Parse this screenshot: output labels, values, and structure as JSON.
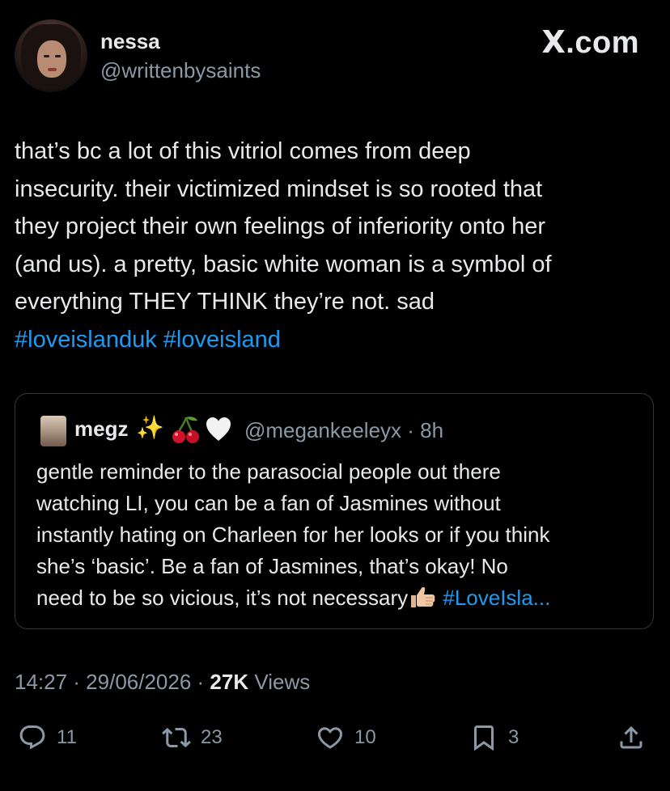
{
  "author": {
    "display_name": "nessa",
    "handle": "@writtenbysaints"
  },
  "watermark": "X.com",
  "tweet": {
    "lines": [
      "that’s bc a lot of this vitriol comes from deep",
      "insecurity. their victimized mindset is so rooted that",
      "they project their own feelings of inferiority onto her",
      "(and us). a pretty, basic white woman is a symbol of",
      "everything THEY THINK they’re not. sad"
    ],
    "hashtags": [
      "#loveislanduk",
      "#loveisland"
    ]
  },
  "quote": {
    "display_name": "megz",
    "handle_time": "@megankeeleyx · 8h",
    "lines": [
      "gentle reminder to the parasocial people out there",
      "watching LI, you can be a fan of Jasmines without",
      "instantly hating on Charleen for her looks or if you think",
      "she’s ‘basic’. Be a fan of Jasmines, that’s okay! No"
    ],
    "last_line_text": "need to be so vicious, it’s not necessary",
    "last_line_tag": "#LoveIsla..."
  },
  "meta": {
    "time_date": "14:27 · 29/06/2026 · ",
    "views_count": "27K",
    "views_label": " Views"
  },
  "actions": {
    "replies": "11",
    "reposts": "23",
    "likes": "10",
    "bookmarks": "3"
  },
  "colors": {
    "background": "#000000",
    "text": "#e7e9ea",
    "secondary": "#8b98a5",
    "link": "#1d9bf0",
    "border": "#333639"
  },
  "icons": [
    "reply-icon",
    "repost-icon",
    "like-icon",
    "bookmark-icon",
    "share-icon",
    "sparkles-emoji",
    "cherries-emoji",
    "white-heart-emoji",
    "thumbs-up-emoji"
  ]
}
